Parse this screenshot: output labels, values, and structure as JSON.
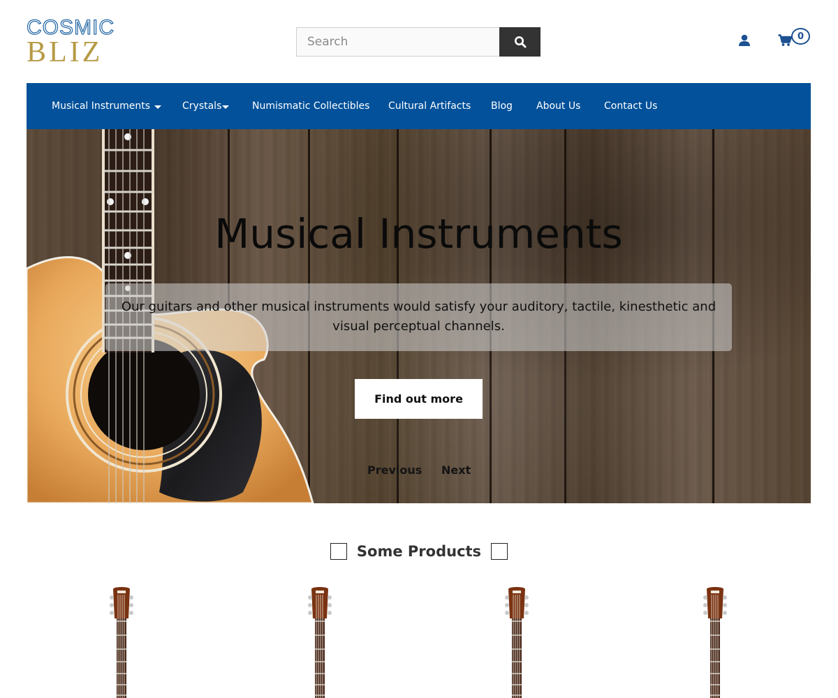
{
  "brand": {
    "line1": "COSMIC",
    "line2": "BLIZ"
  },
  "search": {
    "placeholder": "Search"
  },
  "cart": {
    "count": "0"
  },
  "nav": {
    "items": [
      {
        "label": "Musical Instruments",
        "dropdown": true
      },
      {
        "label": "Crystals",
        "dropdown": true
      },
      {
        "label": "Numismatic Collectibles",
        "dropdown": false
      },
      {
        "label": "Cultural Artifacts",
        "dropdown": false
      },
      {
        "label": "Blog",
        "dropdown": false
      },
      {
        "label": "About Us",
        "dropdown": false
      },
      {
        "label": "Contact Us",
        "dropdown": false
      }
    ]
  },
  "hero": {
    "title": "Musical Instruments",
    "description": "Our guitars and other musical instruments would satisfy your auditory, tactile, kinesthetic and visual perceptual channels.",
    "cta": "Find out more",
    "prev": "Previous",
    "next": "Next"
  },
  "products": {
    "heading": "Some Products",
    "count_visible": 4
  },
  "colors": {
    "nav_bg": "#02519a",
    "accent": "#1c5192",
    "logo_blue": "#2e6ea8",
    "logo_gold": "#b59a45",
    "search_button": "#333333"
  },
  "icons": {
    "search": "search-icon",
    "user": "user-icon",
    "cart": "cart-icon",
    "caret": "caret-down-icon"
  }
}
